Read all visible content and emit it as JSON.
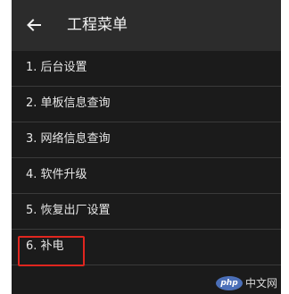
{
  "header": {
    "title": "工程菜单",
    "back_icon": "arrow-left-icon"
  },
  "menu": {
    "items": [
      {
        "label": "1. 后台设置"
      },
      {
        "label": "2. 单板信息查询"
      },
      {
        "label": "3. 网络信息查询"
      },
      {
        "label": "4. 软件升级"
      },
      {
        "label": "5. 恢复出厂设置"
      },
      {
        "label": "6. 补电"
      }
    ],
    "highlight_color": "#e0261f"
  },
  "watermark": {
    "logo_text": "php",
    "site_text": "中文网"
  },
  "colors": {
    "appbar_bg": "#2c2c2c",
    "list_bg": "#1b1b1b",
    "text": "#e6e6e6"
  }
}
